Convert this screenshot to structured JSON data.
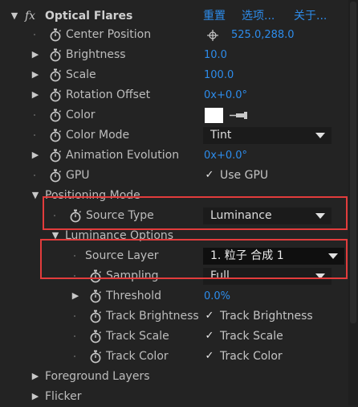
{
  "effect": {
    "name": "Optical Flares",
    "fx": "fx",
    "links": [
      "重置",
      "选项...",
      "关于..."
    ]
  },
  "props": {
    "center_position": {
      "label": "Center Position",
      "value": "525.0,288.0"
    },
    "brightness": {
      "label": "Brightness",
      "value": "10.0"
    },
    "scale": {
      "label": "Scale",
      "value": "100.0"
    },
    "rotation_offset": {
      "label": "Rotation Offset",
      "value": "0x+0.0°"
    },
    "color": {
      "label": "Color",
      "swatch": "#ffffff"
    },
    "color_mode": {
      "label": "Color Mode",
      "value": "Tint"
    },
    "animation_evolution": {
      "label": "Animation Evolution",
      "value": "0x+0.0°"
    },
    "gpu": {
      "label": "GPU",
      "checkbox_label": "Use GPU",
      "checked": true
    }
  },
  "positioning_mode": {
    "label": "Positioning Mode",
    "source_type": {
      "label": "Source Type",
      "value": "Luminance"
    },
    "luminance_options": {
      "label": "Luminance Options",
      "source_layer": {
        "label": "Source Layer",
        "value": "1. 粒子 合成 1"
      },
      "sampling": {
        "label": "Sampling",
        "value": "Full"
      },
      "threshold": {
        "label": "Threshold",
        "value": "0.0%"
      },
      "track_brightness": {
        "label": "Track Brightness",
        "checkbox_label": "Track Brightness",
        "checked": true
      },
      "track_scale": {
        "label": "Track Scale",
        "checkbox_label": "Track Scale",
        "checked": true
      },
      "track_color": {
        "label": "Track Color",
        "checkbox_label": "Track Color",
        "checked": true
      }
    }
  },
  "groups": {
    "foreground_layers": "Foreground Layers",
    "flicker": "Flicker"
  },
  "colors": {
    "accent": "#2d8ceb",
    "highlight": "#e23c3c",
    "background": "#232323"
  }
}
